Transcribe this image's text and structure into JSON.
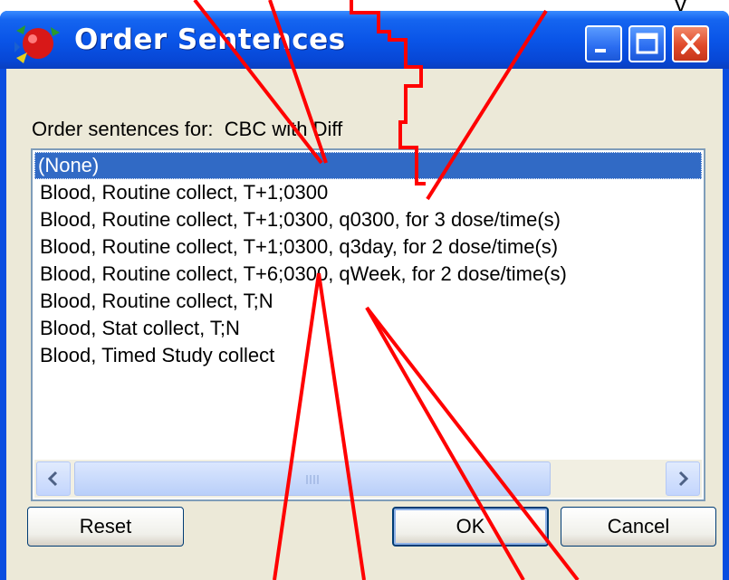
{
  "window": {
    "title": "Order Sentences",
    "controls": {
      "minimize": "minimize",
      "maximize": "maximize",
      "close": "close"
    }
  },
  "top_fragment": "y",
  "dialog": {
    "prompt_label": "Order sentences for:",
    "prompt_value": "CBC with Diff",
    "list_items": [
      "(None)",
      "Blood, Routine collect, T+1;0300",
      "Blood, Routine collect, T+1;0300, q0300, for 3 dose/time(s)",
      "Blood, Routine collect, T+1;0300, q3day, for 2 dose/time(s)",
      "Blood, Routine collect, T+6;0300, qWeek, for 2 dose/time(s)",
      "Blood, Routine collect, T;N",
      "Blood, Stat collect, T;N",
      "Blood, Timed Study collect"
    ],
    "selected_index": 0,
    "buttons": {
      "reset": "Reset",
      "ok": "OK",
      "cancel": "Cancel"
    }
  },
  "colors": {
    "titlebar": "#0a55e8",
    "selection": "#316ac5",
    "dialog_bg": "#ece9d8",
    "annotation": "#ff0000"
  },
  "icons": [
    "app-icon",
    "minimize-icon",
    "maximize-icon",
    "close-icon",
    "scroll-left-icon",
    "scroll-right-icon"
  ]
}
